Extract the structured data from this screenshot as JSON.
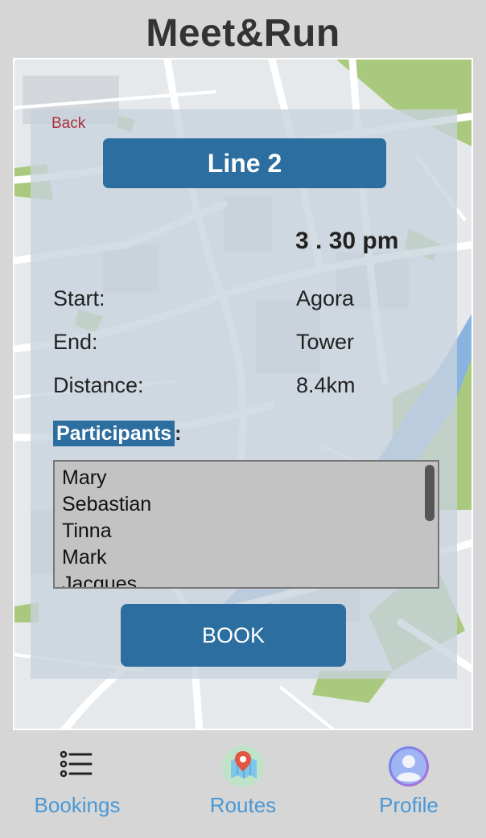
{
  "app": {
    "title": "Meet&Run"
  },
  "route": {
    "back_label": "Back",
    "line_name": "Line 2",
    "time": "3 . 30 pm",
    "start_label": "Start:",
    "start_value": "Agora",
    "end_label": "End:",
    "end_value": "Tower",
    "distance_label": "Distance:",
    "distance_value": "8.4km",
    "participants_label": "Participants",
    "participants_colon": ":",
    "participants": [
      "Mary",
      "Sebastian",
      "Tinna",
      "Mark",
      "Jacques"
    ],
    "book_label": "BOOK"
  },
  "nav": {
    "items": [
      {
        "label": "Bookings",
        "icon": "list-icon"
      },
      {
        "label": "Routes",
        "icon": "map-pin-icon"
      },
      {
        "label": "Profile",
        "icon": "profile-icon"
      }
    ]
  },
  "colors": {
    "primary": "#2c6e9f",
    "nav_label": "#4b98d4",
    "back_link": "#a5323e",
    "water": "#8ab4e0",
    "park": "#a9c97e"
  }
}
